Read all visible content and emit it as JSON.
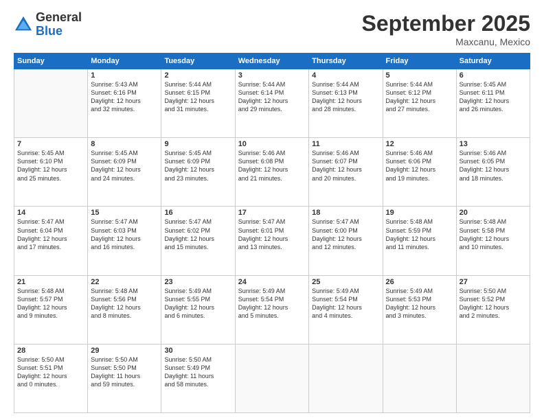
{
  "logo": {
    "general": "General",
    "blue": "Blue"
  },
  "header": {
    "month": "September 2025",
    "location": "Maxcanu, Mexico"
  },
  "weekdays": [
    "Sunday",
    "Monday",
    "Tuesday",
    "Wednesday",
    "Thursday",
    "Friday",
    "Saturday"
  ],
  "weeks": [
    [
      {
        "day": "",
        "info": ""
      },
      {
        "day": "1",
        "info": "Sunrise: 5:43 AM\nSunset: 6:16 PM\nDaylight: 12 hours\nand 32 minutes."
      },
      {
        "day": "2",
        "info": "Sunrise: 5:44 AM\nSunset: 6:15 PM\nDaylight: 12 hours\nand 31 minutes."
      },
      {
        "day": "3",
        "info": "Sunrise: 5:44 AM\nSunset: 6:14 PM\nDaylight: 12 hours\nand 29 minutes."
      },
      {
        "day": "4",
        "info": "Sunrise: 5:44 AM\nSunset: 6:13 PM\nDaylight: 12 hours\nand 28 minutes."
      },
      {
        "day": "5",
        "info": "Sunrise: 5:44 AM\nSunset: 6:12 PM\nDaylight: 12 hours\nand 27 minutes."
      },
      {
        "day": "6",
        "info": "Sunrise: 5:45 AM\nSunset: 6:11 PM\nDaylight: 12 hours\nand 26 minutes."
      }
    ],
    [
      {
        "day": "7",
        "info": "Sunrise: 5:45 AM\nSunset: 6:10 PM\nDaylight: 12 hours\nand 25 minutes."
      },
      {
        "day": "8",
        "info": "Sunrise: 5:45 AM\nSunset: 6:09 PM\nDaylight: 12 hours\nand 24 minutes."
      },
      {
        "day": "9",
        "info": "Sunrise: 5:45 AM\nSunset: 6:09 PM\nDaylight: 12 hours\nand 23 minutes."
      },
      {
        "day": "10",
        "info": "Sunrise: 5:46 AM\nSunset: 6:08 PM\nDaylight: 12 hours\nand 21 minutes."
      },
      {
        "day": "11",
        "info": "Sunrise: 5:46 AM\nSunset: 6:07 PM\nDaylight: 12 hours\nand 20 minutes."
      },
      {
        "day": "12",
        "info": "Sunrise: 5:46 AM\nSunset: 6:06 PM\nDaylight: 12 hours\nand 19 minutes."
      },
      {
        "day": "13",
        "info": "Sunrise: 5:46 AM\nSunset: 6:05 PM\nDaylight: 12 hours\nand 18 minutes."
      }
    ],
    [
      {
        "day": "14",
        "info": "Sunrise: 5:47 AM\nSunset: 6:04 PM\nDaylight: 12 hours\nand 17 minutes."
      },
      {
        "day": "15",
        "info": "Sunrise: 5:47 AM\nSunset: 6:03 PM\nDaylight: 12 hours\nand 16 minutes."
      },
      {
        "day": "16",
        "info": "Sunrise: 5:47 AM\nSunset: 6:02 PM\nDaylight: 12 hours\nand 15 minutes."
      },
      {
        "day": "17",
        "info": "Sunrise: 5:47 AM\nSunset: 6:01 PM\nDaylight: 12 hours\nand 13 minutes."
      },
      {
        "day": "18",
        "info": "Sunrise: 5:47 AM\nSunset: 6:00 PM\nDaylight: 12 hours\nand 12 minutes."
      },
      {
        "day": "19",
        "info": "Sunrise: 5:48 AM\nSunset: 5:59 PM\nDaylight: 12 hours\nand 11 minutes."
      },
      {
        "day": "20",
        "info": "Sunrise: 5:48 AM\nSunset: 5:58 PM\nDaylight: 12 hours\nand 10 minutes."
      }
    ],
    [
      {
        "day": "21",
        "info": "Sunrise: 5:48 AM\nSunset: 5:57 PM\nDaylight: 12 hours\nand 9 minutes."
      },
      {
        "day": "22",
        "info": "Sunrise: 5:48 AM\nSunset: 5:56 PM\nDaylight: 12 hours\nand 8 minutes."
      },
      {
        "day": "23",
        "info": "Sunrise: 5:49 AM\nSunset: 5:55 PM\nDaylight: 12 hours\nand 6 minutes."
      },
      {
        "day": "24",
        "info": "Sunrise: 5:49 AM\nSunset: 5:54 PM\nDaylight: 12 hours\nand 5 minutes."
      },
      {
        "day": "25",
        "info": "Sunrise: 5:49 AM\nSunset: 5:54 PM\nDaylight: 12 hours\nand 4 minutes."
      },
      {
        "day": "26",
        "info": "Sunrise: 5:49 AM\nSunset: 5:53 PM\nDaylight: 12 hours\nand 3 minutes."
      },
      {
        "day": "27",
        "info": "Sunrise: 5:50 AM\nSunset: 5:52 PM\nDaylight: 12 hours\nand 2 minutes."
      }
    ],
    [
      {
        "day": "28",
        "info": "Sunrise: 5:50 AM\nSunset: 5:51 PM\nDaylight: 12 hours\nand 0 minutes."
      },
      {
        "day": "29",
        "info": "Sunrise: 5:50 AM\nSunset: 5:50 PM\nDaylight: 11 hours\nand 59 minutes."
      },
      {
        "day": "30",
        "info": "Sunrise: 5:50 AM\nSunset: 5:49 PM\nDaylight: 11 hours\nand 58 minutes."
      },
      {
        "day": "",
        "info": ""
      },
      {
        "day": "",
        "info": ""
      },
      {
        "day": "",
        "info": ""
      },
      {
        "day": "",
        "info": ""
      }
    ]
  ]
}
